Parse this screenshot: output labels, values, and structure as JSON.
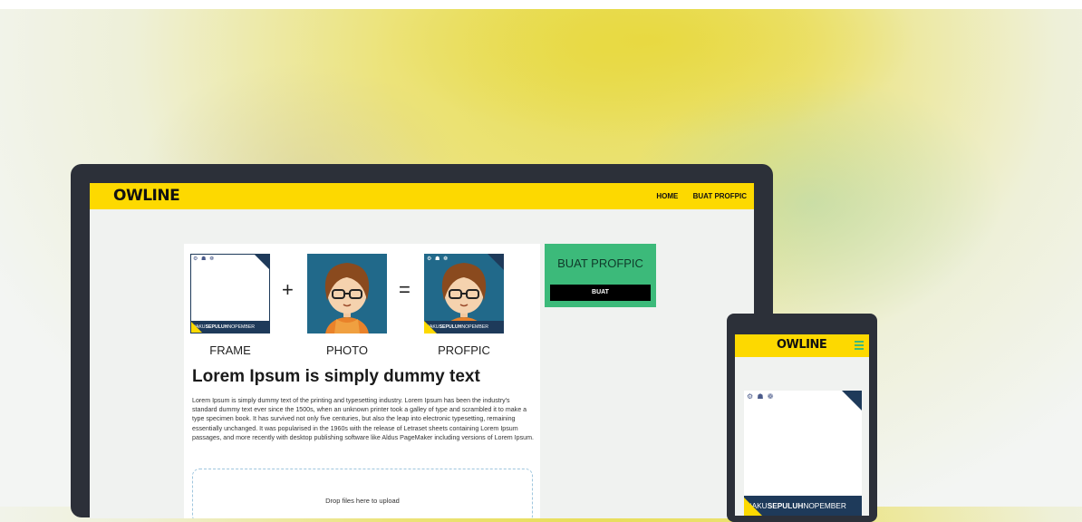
{
  "brand": {
    "logo": "OWLINE",
    "accent": "#fdd900",
    "green": "#3cba7a",
    "navy": "#1e3a5a"
  },
  "nav": {
    "home": "HOME",
    "buat_profpic": "BUAT PROFPIC"
  },
  "steps": {
    "plus": "+",
    "equals": "=",
    "frame_label": "FRAME",
    "photo_label": "PHOTO",
    "profpic_label": "PROFPIC",
    "hashtag_prefix": "#AKU",
    "hashtag_bold": "SEPULUH",
    "hashtag_suffix": "NOPEMBER"
  },
  "main": {
    "heading": "Lorem Ipsum is simply dummy text",
    "paragraph": "Lorem Ipsum is simply dummy text of the printing and typesetting industry. Lorem Ipsum has been the industry's standard dummy text ever since the 1500s, when an unknown printer took a galley of type and scrambled it to make a type specimen book. It has survived not only five centuries, but also the leap into electronic typesetting, remaining essentially unchanged. It was popularised in the 1960s with the release of Letraset sheets containing Lorem Ipsum passages, and more recently with desktop publishing software like Aldus PageMaker including versions of Lorem Ipsum.",
    "dropzone": "Drop files here to upload"
  },
  "sidebar": {
    "title": "BUAT PROFPIC",
    "button": "BUAT"
  },
  "mobile": {
    "logo": "OWLINE"
  }
}
